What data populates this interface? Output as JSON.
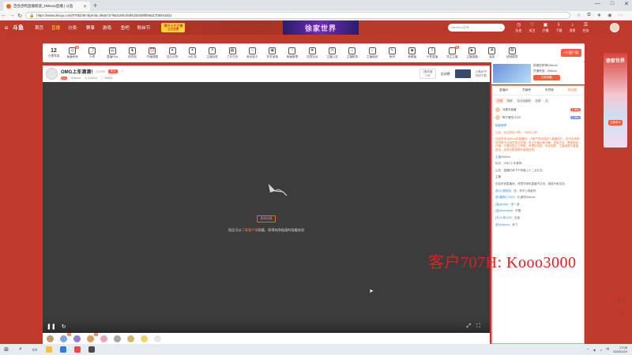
{
  "browser": {
    "tab_title": "百合虎鸭直播频道_DMeow直播 | 斗鱼",
    "new_tab": "+",
    "url": "https://www.douyu.com/5705236?dyshid=39de72-f9a219fccb8f43304d9bf56a1705641601",
    "window_controls": [
      "—",
      "□",
      "✕"
    ],
    "nav": [
      "←",
      "→",
      "↻"
    ]
  },
  "header": {
    "logo": "斗鱼",
    "nav": [
      "首页",
      "直播",
      "分类·",
      "赛事",
      "游戏·",
      "鱼吧",
      "粉丝节"
    ],
    "badge_line1": "揭开十大主播",
    "badge_line2": "正在投票",
    "banner": "徐家世界",
    "search_placeholder": "ultraRex没有",
    "icons": [
      "历史",
      "关注",
      "开播",
      "下载",
      "消息",
      "任务"
    ]
  },
  "tools": {
    "level_number": "12",
    "level_label": "主播等级",
    "items": [
      "鱼塘养鱼",
      "分享",
      "直播Plus",
      "修改狗",
      "开播提醒",
      "百位点赞",
      "AI礼物",
      "主播标签",
      "工作日历",
      "鱼玩抽卡",
      "任务宝箱",
      "鱼塘管理",
      "花园互动",
      "主播公告",
      "主播歌单",
      "主播值班",
      "鱼吧",
      "荣耀值",
      "分享直播",
      "关注主播",
      "主播直播",
      "抽奖",
      "成就徽章"
    ],
    "badges": {
      "0": "热",
      "19": "新"
    },
    "pc_button": "PC客户端"
  },
  "room": {
    "title": "OMG上车滴滴!",
    "room_id": "125783",
    "follow": "关注",
    "level": "Lv",
    "anchor": "DMeow",
    "heat": "◎ 413913",
    "fans": "♡ 30564",
    "stat_label": "1周热度",
    "stat_value": "178",
    "all_sites": "全站榜",
    "app_label": "斗鱼APP",
    "app_sub": "扫码下载"
  },
  "player": {
    "open_button": "重新加载",
    "message_pre": "您还可以",
    "message_highlight": "下载客户端",
    "message_post": "观看，获得纯净极速的观看体验"
  },
  "side": {
    "promo_title": "恭喜您获得DMeow！",
    "promo_line2": "开通贵族 · DMeow",
    "promo_btn": "立即领取"
  },
  "chat": {
    "tabs": [
      "直播间",
      "贡献榜",
      "贵宾席",
      "粉丝团"
    ],
    "active_tab": 3,
    "sub_tabs": [
      "日榜",
      "周榜",
      "本月贡献榜",
      "总榜",
      "月"
    ],
    "ranks": [
      {
        "name": "冰雪天使酱",
        "btn": "1.98w"
      },
      {
        "name": "鸭子爱吃11100",
        "btn": "1.98w"
      }
    ],
    "messages": [
      {
        "name": "超级管理",
        "text": ""
      },
      {
        "name": "",
        "text": "公告：欢迎来到小鸭！一起玩儿吧！"
      },
      {
        "name": "",
        "text": "欢迎来到DMeow的直播间。小鱼严禁未成年人直播送礼，若涉及违规将依照平台相关规定处理。禁止传播涉黄涉暴、低俗内容。警惕网络诈骗，不要向陌生人转账。请理性消费，安全观看，主播请遵守直播规范，如有问题请联系客服处理。"
      },
      {
        "name": "主播",
        "text": "DMeow"
      },
      {
        "name": "",
        "text": "玩法：OMG上车滴滴!"
      },
      {
        "name": "",
        "text": "公告：直播时间下午到晚上十二点左右。"
      },
      {
        "name": "",
        "text": "主播"
      },
      {
        "name": "",
        "text": "欢迎来到直播间，请遵守绿色直播不引战，谢谢大家支持。"
      },
      {
        "name": "(粉)小猫哈哈：",
        "text": "哇，你不上电影吗"
      },
      {
        "name": "(粉)酸鸭171819：",
        "text": "牛逼的DMeow"
      },
      {
        "name": "(蓝)jieyliye：",
        "text": "来一波"
      },
      {
        "name": "(蓝)Moonwdip：",
        "text": "好酷"
      },
      {
        "name": "(灰)小鱼1234：",
        "text": "加油"
      },
      {
        "name": "(粉)DMeow：",
        "text": "来了"
      }
    ]
  },
  "watermark": "客户707H: Kooo3000",
  "ad": {
    "title": "徐家世界",
    "sub": "立即参与"
  },
  "taskbar": {
    "time": "17:08",
    "date": "2024/1/19",
    "lang": "中"
  }
}
